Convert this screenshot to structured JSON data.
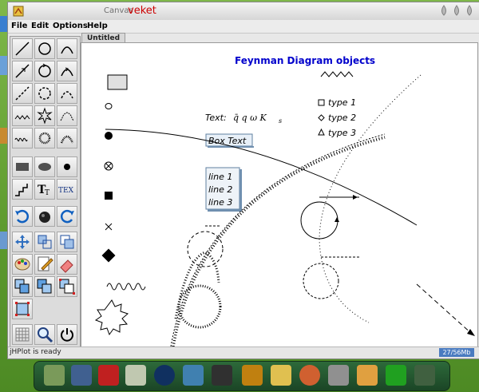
{
  "window": {
    "title_small": "Canvas",
    "title_app": "veket"
  },
  "menu": {
    "items": [
      "File",
      "Edit",
      "Options",
      "Help"
    ]
  },
  "tabs": [
    "Untitled"
  ],
  "canvas": {
    "title": "Feynman Diagram objects",
    "text_label": "Text:",
    "math_text": "q̄  q ω K",
    "math_sub": "s",
    "box_text": "Box Text",
    "lines": [
      "line 1",
      "line 2",
      "line 3"
    ],
    "legend": [
      "type 1",
      "type 2",
      "type 3"
    ]
  },
  "status": {
    "text": "jHPlot is ready",
    "memory": "27/56Mb"
  },
  "toolbar": {
    "icons": [
      "line-tool-icon",
      "circle-tool-icon",
      "arrow-line-tool-icon",
      "arrow-circle-tool-icon",
      "dashed-line-tool-icon",
      "dashed-circle-tool-icon",
      "gluon-tool-icon",
      "gluon-loop-tool-icon",
      "coil-tool-icon",
      "coil-loop-tool-icon",
      "rectangle-tool-icon",
      "ellipse-tool-icon",
      "dot-tool-icon",
      "step-tool-icon",
      "text-tool-icon",
      "tex-tool-icon",
      "undo-icon",
      "sphere-icon",
      "redo-icon",
      "move-icon",
      "resize-icon",
      "copy-icon",
      "palette-icon",
      "edit-icon",
      "eraser-icon",
      "group-icon",
      "ungroup-icon",
      "select-icon",
      "select-box-icon",
      "grid-icon",
      "zoom-icon",
      "power-icon"
    ]
  },
  "dock": {
    "icons": [
      "chart-icon",
      "monitor-icon",
      "game-icon",
      "notes-icon",
      "web-icon",
      "users-icon",
      "tux-icon",
      "exit-icon",
      "image-viewer-icon",
      "paint-icon",
      "pen-icon",
      "photo-icon",
      "check-icon",
      "terminal-icon"
    ]
  },
  "colors": {
    "title_blue": "#0000cc",
    "app_red": "#cc0000",
    "desktop_green": "#6aa53a"
  }
}
